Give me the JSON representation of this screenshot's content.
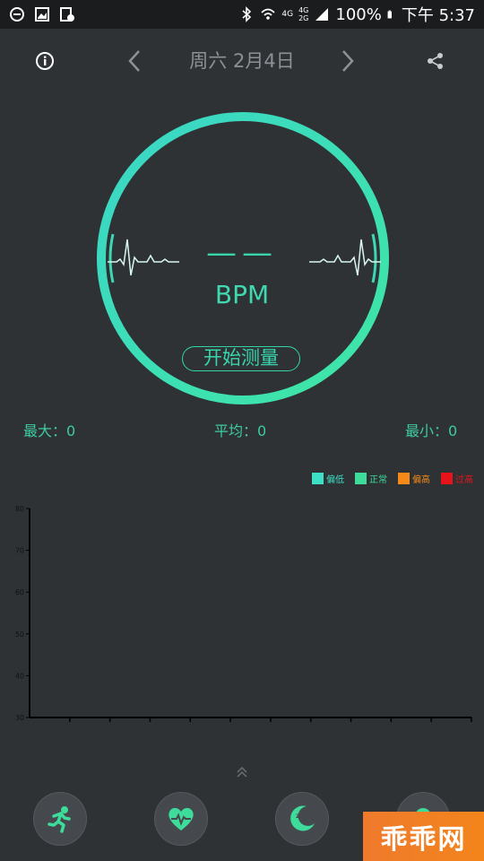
{
  "status_bar": {
    "battery_percent": "100%",
    "time": "下午 5:37",
    "network_top": "4G",
    "network_bottom": "4G",
    "network_extra": "2G"
  },
  "header": {
    "date": "周六  2月4日"
  },
  "measurement": {
    "value": "——",
    "unit": "BPM",
    "start_button": "开始测量"
  },
  "stats": {
    "max": "最大：0",
    "avg": "平均：0",
    "min": "最小：0"
  },
  "legend": [
    {
      "label": "偏低",
      "color": "#3ee0c5"
    },
    {
      "label": "正常",
      "color": "#3ddc9a"
    },
    {
      "label": "偏高",
      "color": "#f58a18"
    },
    {
      "label": "过高",
      "color": "#e8121a"
    }
  ],
  "chart_data": {
    "type": "bar",
    "y_ticks": [
      30,
      40,
      50,
      60,
      70,
      80
    ],
    "ylim": [
      30,
      80
    ],
    "x_tick_count": 11,
    "values": []
  },
  "bottom_tabs": [
    "run-tab",
    "heart-tab",
    "sleep-tab",
    "profile-tab"
  ],
  "watermark": "乖乖网"
}
